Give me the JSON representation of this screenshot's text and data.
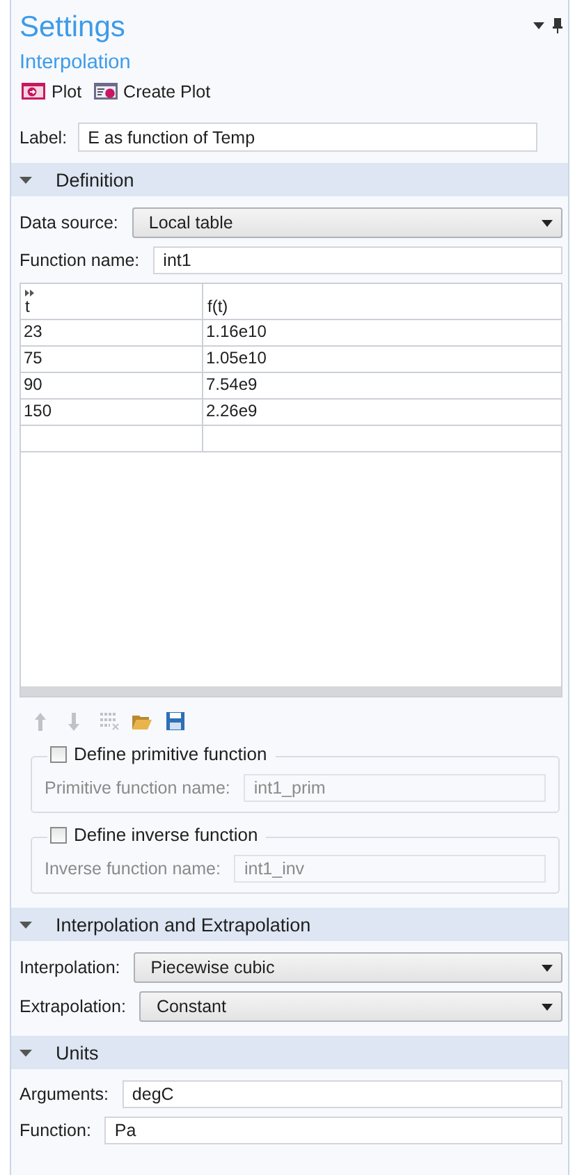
{
  "header": {
    "title": "Settings",
    "subtitle": "Interpolation",
    "actions": [
      {
        "kind": "plot",
        "label": "Plot"
      },
      {
        "kind": "create_plot",
        "label": "Create Plot"
      }
    ],
    "label_field": {
      "label": "Label:",
      "value": "E as function of Temp"
    }
  },
  "sections": [
    {
      "title": "Definition",
      "expanded": true,
      "items": [
        {
          "kind": "select",
          "label": "Data source:",
          "value": "Local table"
        },
        {
          "kind": "input",
          "label": "Function name:",
          "value": "int1"
        },
        {
          "kind": "table",
          "columns": [
            "t",
            "f(t)"
          ],
          "rows": [
            [
              "23",
              "1.16e10"
            ],
            [
              "75",
              "1.05e10"
            ],
            [
              "90",
              "7.54e9"
            ],
            [
              "150",
              "2.26e9"
            ]
          ]
        },
        {
          "kind": "toolbar",
          "buttons": [
            {
              "disabled": true
            },
            {
              "disabled": true
            },
            {
              "disabled": true
            },
            {
              "disabled": false
            },
            {
              "disabled": false
            }
          ]
        },
        {
          "kind": "group",
          "checkbox": "Define primitive function",
          "checked": false,
          "label": "Primitive function name:",
          "value": "int1_prim",
          "disabled": true
        },
        {
          "kind": "group",
          "checkbox": "Define inverse function",
          "checked": false,
          "label": "Inverse function name:",
          "value": "int1_inv",
          "disabled": true
        }
      ]
    },
    {
      "title": "Interpolation and Extrapolation",
      "expanded": true,
      "items": [
        {
          "kind": "select",
          "label": "Interpolation:",
          "value": "Piecewise cubic"
        },
        {
          "kind": "select",
          "label": "Extrapolation:",
          "value": "Constant"
        }
      ]
    },
    {
      "title": "Units",
      "expanded": true,
      "items": [
        {
          "kind": "input",
          "label": "Arguments:",
          "value": "degC"
        },
        {
          "kind": "input",
          "label": "Function:",
          "value": "Pa"
        }
      ]
    }
  ]
}
